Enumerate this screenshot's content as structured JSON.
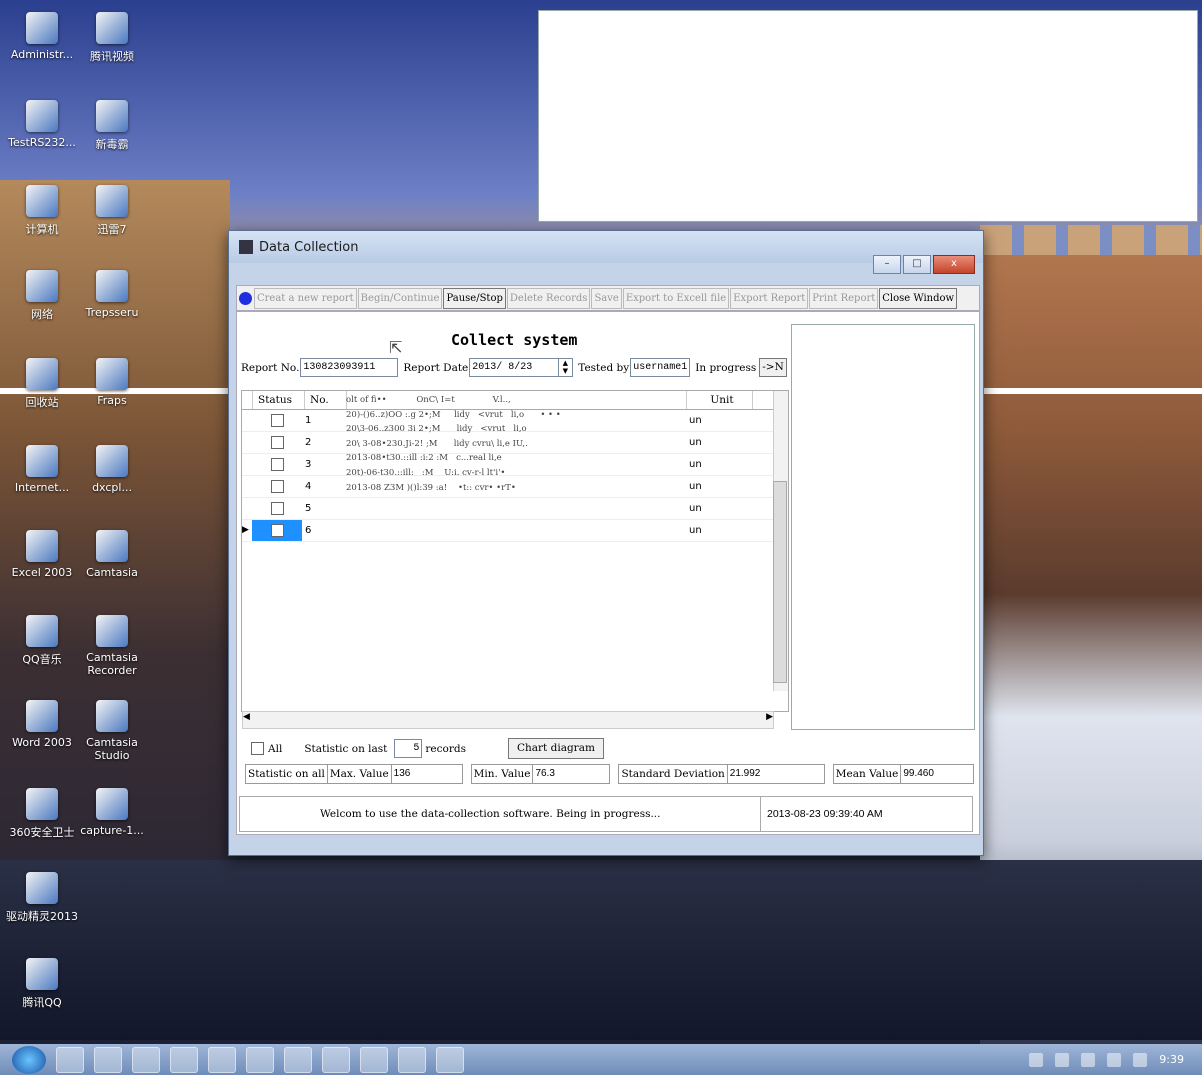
{
  "desktop": {
    "icons": [
      {
        "label": "Administr..."
      },
      {
        "label": "腾讯视频"
      },
      {
        "label": "TestRS232..."
      },
      {
        "label": "新毒霸"
      },
      {
        "label": "计算机"
      },
      {
        "label": "迅雷7"
      },
      {
        "label": "网络"
      },
      {
        "label": "Trepsseru"
      },
      {
        "label": "回收站"
      },
      {
        "label": "Fraps"
      },
      {
        "label": "Internet..."
      },
      {
        "label": "dxcpl..."
      },
      {
        "label": "Excel 2003"
      },
      {
        "label": "Camtasia"
      },
      {
        "label": "QQ音乐"
      },
      {
        "label": "Camtasia Recorder"
      },
      {
        "label": "Word 2003"
      },
      {
        "label": "Camtasia Studio"
      },
      {
        "label": "360安全卫士"
      },
      {
        "label": "capture-1..."
      },
      {
        "label": "驱动精灵2013"
      },
      {
        "label": "腾讯QQ"
      }
    ]
  },
  "window": {
    "title": "Data Collection",
    "controls": {
      "minimize": "–",
      "maximize": "□",
      "close": "x"
    },
    "toolbar": [
      {
        "label": "Creat a new report",
        "enabled": false
      },
      {
        "label": "Begin/Continue",
        "enabled": false
      },
      {
        "label": "Pause/Stop",
        "enabled": true
      },
      {
        "label": "Delete Records",
        "enabled": false
      },
      {
        "label": "Save",
        "enabled": false
      },
      {
        "label": "Export to Excell file",
        "enabled": false
      },
      {
        "label": "Export Report",
        "enabled": false
      },
      {
        "label": "Print Report",
        "enabled": false
      },
      {
        "label": "Close Window",
        "enabled": true
      }
    ],
    "heading": "Collect system",
    "report_no_label": "Report No.",
    "report_no": "130823093911",
    "report_date_label": "Report Date",
    "report_date": "2013/ 8/23",
    "tested_by_label": "Tested by",
    "tested_by": "username1",
    "progress_label": "In progress",
    "progress_btn": "->N",
    "grid": {
      "columns": [
        "Status",
        "No.",
        "Unit"
      ],
      "rows": [
        {
          "no": "1",
          "unit": "un"
        },
        {
          "no": "2",
          "unit": "un"
        },
        {
          "no": "3",
          "unit": "un"
        },
        {
          "no": "4",
          "unit": "un"
        },
        {
          "no": "5",
          "unit": "un"
        },
        {
          "no": "6",
          "unit": "un",
          "selected": true
        }
      ],
      "garbled": "olt of fi••           OnC\\ I=t              V.l..,\n20)-()6..z)OO :.g 2•;M     lidy   <vrut   li,o      • • •\n20\\3-06..z300 3i 2•;M      lidy   <vrut   li,o\n20\\ 3-08•230.Ji-2! ;M      lidy cvru\\ li,e IU,.\n2013-08•t30.::ill :i:2 :M   c...real li,e\n20t)-06-t30.::ill:   :M    U:i. cv-r-l lt'i'•\n2013-08 Z3M )()l:39 :a!    •t:: cvr• •rT•"
    },
    "stats": {
      "all_label": "All",
      "statistic_on_last": "Statistic on last",
      "last_count": "5",
      "records_label": "records",
      "chart_btn": "Chart diagram",
      "statistic_on_all": "Statistic on all",
      "max_label": "Max. Value",
      "max_value": "136",
      "min_label": "Min. Value",
      "min_value": "76.3",
      "std_label": "Standard Deviation",
      "std_value": "21.992",
      "mean_label": "Mean Value",
      "mean_value": "99.460"
    },
    "status": {
      "message": "Welcom to use the data-collection software. Being in progress...",
      "time": "2013-08-23 09:39:40 AM"
    }
  },
  "taskbar": {
    "clock": "9:39"
  }
}
